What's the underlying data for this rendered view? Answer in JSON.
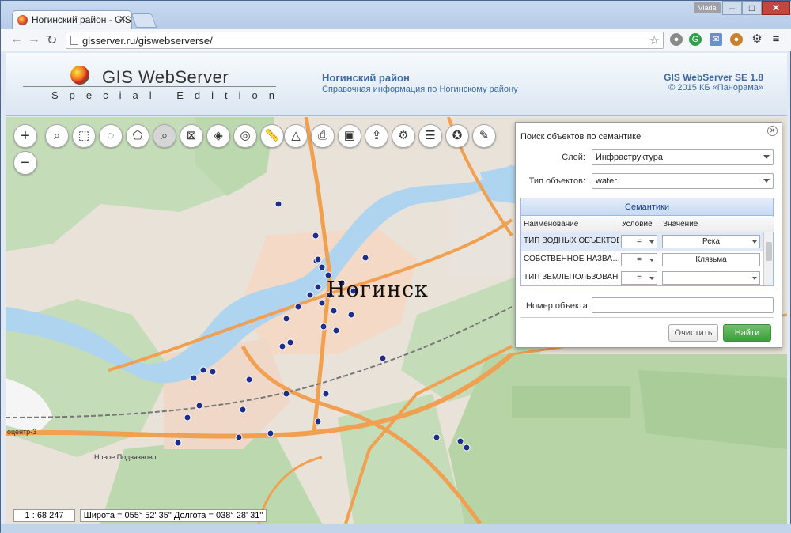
{
  "browser": {
    "tab_title": "Ногинский район - GIS W",
    "tab_close": "✕",
    "user_badge": "Vlada",
    "url": "gisserver.ru/giswebserverse/",
    "window_controls": {
      "minimize": "–",
      "maximize": "□",
      "close": "✕"
    }
  },
  "header": {
    "app_title": "GIS WebServer",
    "app_subtitle": "Special Edition",
    "region_title": "Ногинский район",
    "region_subtitle": "Справочная информация по Ногинскому району",
    "version_title": "GIS WebServer SE 1.8",
    "version_subtitle": "© 2015 КБ «Панорама»"
  },
  "map": {
    "city_label": "Ногинск",
    "labels": [
      "оцентр-3",
      "Новое Подвязново"
    ]
  },
  "toolbar": {
    "zoom_in": "+",
    "zoom_out": "−",
    "icons": [
      "search-icon",
      "select-icon",
      "select-circle-icon",
      "select-polygon-icon",
      "search-area-icon",
      "clear-selection-icon",
      "layers-icon",
      "map-view-icon",
      "ruler-icon",
      "area-measure-icon",
      "print-icon",
      "export-icon",
      "share-icon",
      "settings-icon",
      "list-icon",
      "info-icon",
      "edit-icon"
    ]
  },
  "search_panel": {
    "title": "Поиск объектов по семантике",
    "layer_label": "Слой:",
    "layer_value": "Инфраструктура",
    "type_label": "Тип объектов:",
    "type_value": "water",
    "semantics_header": "Семантики",
    "columns": [
      "Наименование",
      "Условие",
      "Значение"
    ],
    "rows": [
      {
        "name": "ТИП ВОДНЫХ ОБЪЕКТОВ",
        "condition": "=",
        "value": "Река"
      },
      {
        "name": "СОБСТВЕННОЕ НАЗВА…",
        "condition": "=",
        "value": "Клязьма"
      },
      {
        "name": "ТИП ЗЕМЛЕПОЛЬЗОВАН…",
        "condition": "=",
        "value": ""
      }
    ],
    "object_number_label": "Номер объекта:",
    "object_number_value": "",
    "clear_button": "Очистить",
    "find_button": "Найти"
  },
  "status": {
    "scale": "1 : 68 247",
    "coordinates": "Широта = 055° 52' 35\" Долгота = 038° 28' 31\""
  }
}
